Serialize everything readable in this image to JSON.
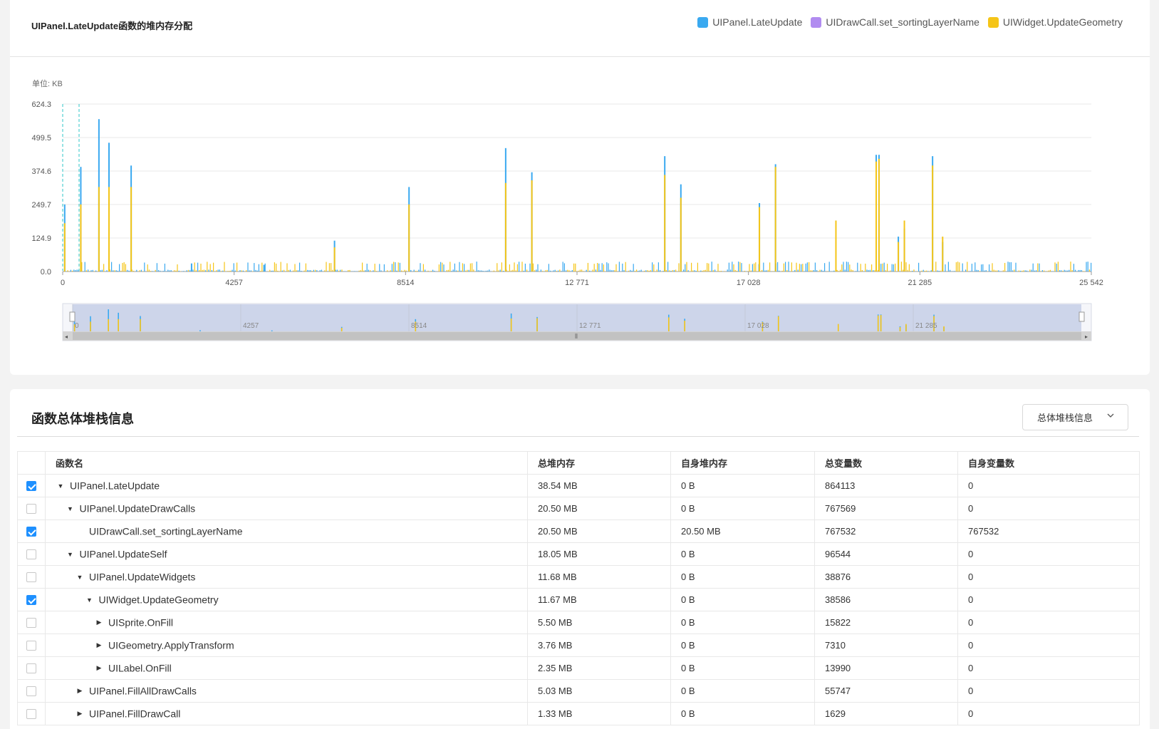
{
  "chart": {
    "title": "UIPanel.LateUpdate函数的堆内存分配",
    "unit_label": "单位: KB",
    "legend": [
      {
        "name": "UIPanel.LateUpdate",
        "color": "#3aa9f0"
      },
      {
        "name": "UIDrawCall.set_sortingLayerName",
        "color": "#b18cf0"
      },
      {
        "name": "UIWidget.UpdateGeometry",
        "color": "#f5c518"
      }
    ]
  },
  "chart_data": {
    "type": "bar",
    "ylabel": "单位: KB",
    "ylim": [
      0,
      624.3
    ],
    "yticks": [
      "0.0",
      "124.9",
      "249.7",
      "374.6",
      "499.5",
      "624.3"
    ],
    "xlim": [
      0,
      25542
    ],
    "xticks": [
      "0",
      "4257",
      "8514",
      "12 771",
      "17 028",
      "21 285",
      "25 542"
    ],
    "zoom_xticks": [
      "0",
      "4257",
      "8514",
      "12 771",
      "17 028",
      "21 285"
    ],
    "series": [
      {
        "name": "UIPanel.LateUpdate",
        "x": [
          50,
          450,
          900,
          1150,
          1700,
          3200,
          5000,
          6750,
          8600,
          11000,
          11650,
          14950,
          15350,
          17300,
          17700,
          20200,
          20270,
          20750,
          20900,
          21600,
          21850
        ],
        "values": [
          250,
          390,
          568,
          480,
          395,
          30,
          25,
          115,
          315,
          460,
          370,
          430,
          325,
          255,
          400,
          435,
          435,
          130,
          160,
          430,
          110
        ]
      },
      {
        "name": "UIDrawCall.set_sortingLayerName",
        "x": [],
        "values": []
      },
      {
        "name": "UIWidget.UpdateGeometry",
        "x": [
          50,
          450,
          900,
          1150,
          1700,
          6750,
          8600,
          11000,
          11650,
          14950,
          15350,
          17300,
          17700,
          19200,
          20200,
          20270,
          20750,
          20900,
          21600,
          21850
        ],
        "values": [
          180,
          250,
          315,
          315,
          315,
          90,
          250,
          330,
          340,
          360,
          275,
          240,
          390,
          190,
          410,
          420,
          110,
          190,
          395,
          130
        ]
      }
    ]
  },
  "table": {
    "section_title": "函数总体堆栈信息",
    "dropdown_label": "总体堆栈信息",
    "headers": [
      "函数名",
      "总堆内存",
      "自身堆内存",
      "总变量数",
      "自身变量数"
    ],
    "rows": [
      {
        "checked": true,
        "depth": 0,
        "toggle": "expanded",
        "name": "UIPanel.LateUpdate",
        "total_mem": "38.54 MB",
        "self_mem": "0 B",
        "total_vars": "864113",
        "self_vars": "0"
      },
      {
        "checked": false,
        "depth": 1,
        "toggle": "expanded",
        "name": "UIPanel.UpdateDrawCalls",
        "total_mem": "20.50 MB",
        "self_mem": "0 B",
        "total_vars": "767569",
        "self_vars": "0"
      },
      {
        "checked": true,
        "depth": 2,
        "toggle": "none",
        "name": "UIDrawCall.set_sortingLayerName",
        "total_mem": "20.50 MB",
        "self_mem": "20.50 MB",
        "total_vars": "767532",
        "self_vars": "767532"
      },
      {
        "checked": false,
        "depth": 1,
        "toggle": "expanded",
        "name": "UIPanel.UpdateSelf",
        "total_mem": "18.05 MB",
        "self_mem": "0 B",
        "total_vars": "96544",
        "self_vars": "0"
      },
      {
        "checked": false,
        "depth": 2,
        "toggle": "expanded",
        "name": "UIPanel.UpdateWidgets",
        "total_mem": "11.68 MB",
        "self_mem": "0 B",
        "total_vars": "38876",
        "self_vars": "0"
      },
      {
        "checked": true,
        "depth": 3,
        "toggle": "expanded",
        "name": "UIWidget.UpdateGeometry",
        "total_mem": "11.67 MB",
        "self_mem": "0 B",
        "total_vars": "38586",
        "self_vars": "0"
      },
      {
        "checked": false,
        "depth": 4,
        "toggle": "collapsed",
        "name": "UISprite.OnFill",
        "total_mem": "5.50 MB",
        "self_mem": "0 B",
        "total_vars": "15822",
        "self_vars": "0"
      },
      {
        "checked": false,
        "depth": 4,
        "toggle": "collapsed",
        "name": "UIGeometry.ApplyTransform",
        "total_mem": "3.76 MB",
        "self_mem": "0 B",
        "total_vars": "7310",
        "self_vars": "0"
      },
      {
        "checked": false,
        "depth": 4,
        "toggle": "collapsed",
        "name": "UILabel.OnFill",
        "total_mem": "2.35 MB",
        "self_mem": "0 B",
        "total_vars": "13990",
        "self_vars": "0"
      },
      {
        "checked": false,
        "depth": 2,
        "toggle": "collapsed",
        "name": "UIPanel.FillAllDrawCalls",
        "total_mem": "5.03 MB",
        "self_mem": "0 B",
        "total_vars": "55747",
        "self_vars": "0"
      },
      {
        "checked": false,
        "depth": 2,
        "toggle": "collapsed",
        "name": "UIPanel.FillDrawCall",
        "total_mem": "1.33 MB",
        "self_mem": "0 B",
        "total_vars": "1629",
        "self_vars": "0"
      }
    ]
  }
}
